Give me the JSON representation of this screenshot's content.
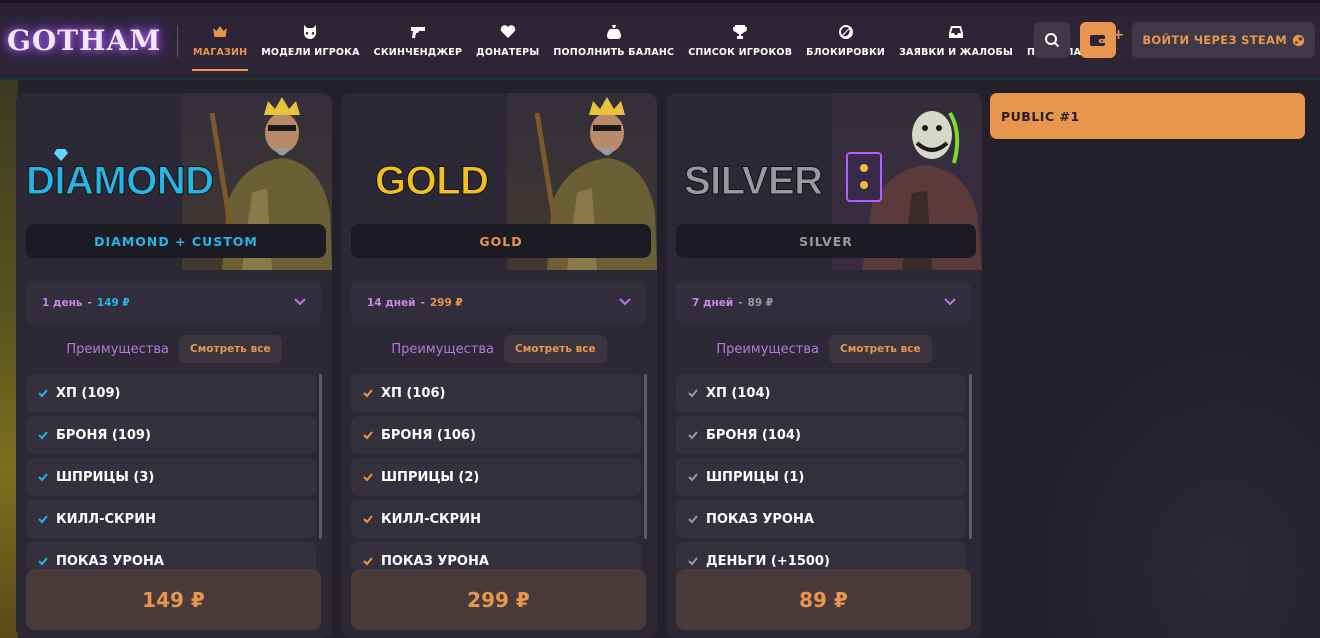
{
  "brand": {
    "logo": "GOTHAM"
  },
  "nav": [
    {
      "label": "МАГАЗИН",
      "icon": "crown-icon",
      "active": true
    },
    {
      "label": "МОДЕЛИ ИГРОКА",
      "icon": "mask-icon",
      "active": false
    },
    {
      "label": "СКИНЧЕНДЖЕР",
      "icon": "gun-icon",
      "active": false
    },
    {
      "label": "ДОНАТЕРЫ",
      "icon": "heart-pulse-icon",
      "active": false
    },
    {
      "label": "ПОПОЛНИТЬ БАЛАНС",
      "icon": "money-bag-icon",
      "active": false
    },
    {
      "label": "СПИСОК ИГРОКОВ",
      "icon": "trophy-icon",
      "active": false
    },
    {
      "label": "БЛОКИРОВКИ",
      "icon": "ban-icon",
      "active": false
    },
    {
      "label": "ЗАЯВКИ И ЖАЛОБЫ",
      "icon": "inbox-icon",
      "active": false
    },
    {
      "label": "ПРАВИЛА",
      "icon": "book-icon",
      "active": false
    }
  ],
  "header": {
    "steam_login": "ВОЙТИ ЧЕРЕЗ STEAM"
  },
  "colors": {
    "accent": "#e8964d",
    "diamond": "#22b7e6",
    "gold": "#e8964d",
    "silver": "#9a9a9e",
    "advantages": "#b57ad8"
  },
  "cards": [
    {
      "title": "DIAMOND",
      "plan": "DIAMOND + CUSTOM",
      "period_days": "1 день",
      "period_price": "149 ₽",
      "advantages_label": "Преимущества",
      "view_all": "Смотреть все",
      "features": [
        "ХП (109)",
        "БРОНЯ (109)",
        "ШПРИЦЫ (3)",
        "КИЛЛ-СКРИН",
        "ПОКАЗ УРОНА"
      ],
      "price": "149 ₽"
    },
    {
      "title": "GOLD",
      "plan": "GOLD",
      "period_days": "14 дней",
      "period_price": "299 ₽",
      "advantages_label": "Преимущества",
      "view_all": "Смотреть все",
      "features": [
        "ХП (106)",
        "БРОНЯ (106)",
        "ШПРИЦЫ (2)",
        "КИЛЛ-СКРИН",
        "ПОКАЗ УРОНА"
      ],
      "price": "299 ₽"
    },
    {
      "title": "SILVER",
      "plan": "SILVER",
      "period_days": "7 дней",
      "period_price": "89 ₽",
      "advantages_label": "Преимущества",
      "view_all": "Смотреть все",
      "features": [
        "ХП (104)",
        "БРОНЯ (104)",
        "ШПРИЦЫ (1)",
        "ПОКАЗ УРОНА",
        "ДЕНЬГИ (+1500)"
      ],
      "price": "89 ₽"
    }
  ],
  "server": {
    "label": "PUBLIC #1"
  }
}
